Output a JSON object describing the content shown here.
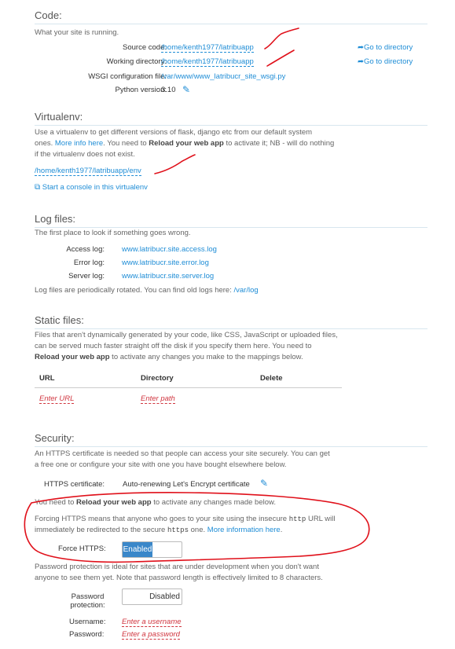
{
  "code": {
    "title": "Code:",
    "desc": "What your site is running.",
    "source_label": "Source code:",
    "source_value": "/home/kenth1977/latribuapp",
    "source_goto": "Go to directory",
    "workdir_label": "Working directory:",
    "workdir_value": "/home/kenth1977/latribuapp",
    "workdir_goto": "Go to directory",
    "wsgi_label": "WSGI configuration file:",
    "wsgi_value": "/var/www/www_latribucr_site_wsgi.py",
    "python_label": "Python version:",
    "python_value": "3.10"
  },
  "virtualenv": {
    "title": "Virtualenv:",
    "text1": "Use a virtualenv to get different versions of flask, django etc from our default system",
    "text2_pre": "ones. ",
    "text2_link": "More info here",
    "text2_mid": ". You need to ",
    "text2_bold": "Reload your web app",
    "text2_post": " to activate it; NB - will do nothing",
    "text3": "if the virtualenv does not exist.",
    "path": "/home/kenth1977/latribuapp/env",
    "console_link": "Start a console in this virtualenv"
  },
  "logs": {
    "title": "Log files:",
    "desc": "The first place to look if something goes wrong.",
    "access_label": "Access log:",
    "access_value": "www.latribucr.site.access.log",
    "error_label": "Error log:",
    "error_value": "www.latribucr.site.error.log",
    "server_label": "Server log:",
    "server_value": "www.latribucr.site.server.log",
    "rotated_text": "Log files are periodically rotated. You can find old logs here: ",
    "rotated_link": "/var/log"
  },
  "static": {
    "title": "Static files:",
    "text1": "Files that aren't dynamically generated by your code, like CSS, JavaScript or uploaded files,",
    "text2": "can be served much faster straight off the disk if you specify them here. You need to",
    "text3_bold": "Reload your web app",
    "text3_post": " to activate any changes you make to the mappings below.",
    "col_url": "URL",
    "col_directory": "Directory",
    "col_delete": "Delete",
    "url_placeholder": "Enter URL",
    "path_placeholder": "Enter path"
  },
  "security": {
    "title": "Security:",
    "text1": "An HTTPS certificate is needed so that people can access your site securely. You can get",
    "text2": "a free one or configure your site with one you have bought elsewhere below.",
    "cert_label": "HTTPS certificate:",
    "cert_value": "Auto-renewing Let's Encrypt certificate",
    "reload_pre": "You need to ",
    "reload_bold": "Reload your web app",
    "reload_post": " to activate any changes made below.",
    "force_text1_pre": "Forcing HTTPS means that anyone who goes to your site using the insecure ",
    "force_text1_code": "http",
    "force_text1_post": " URL will",
    "force_text2_pre": "immediately be redirected to the secure ",
    "force_text2_code": "https",
    "force_text2_mid": " one. ",
    "force_text2_link": "More information here",
    "force_text2_post": ".",
    "force_label": "Force HTTPS:",
    "force_state": "Enabled",
    "pw_text1": "Password protection is ideal for sites that are under development when you don't want",
    "pw_text2": "anyone to see them yet. Note that password length is effectively limited to 8 characters.",
    "pw_label1": "Password",
    "pw_label2": "protection:",
    "pw_state": "Disabled",
    "username_label": "Username:",
    "username_placeholder": "Enter a username",
    "password_label": "Password:",
    "password_placeholder": "Enter a password"
  },
  "colors": {
    "link": "#1f8dd6",
    "placeholder": "#d0353f",
    "toggle_on": "#3a87c9",
    "annotation": "#e0101a"
  },
  "icons": [
    "arrow-share-icon",
    "pencil-icon",
    "console-icon"
  ]
}
